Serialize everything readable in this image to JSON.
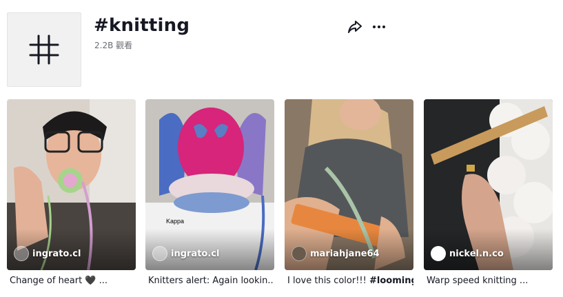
{
  "hashtag": {
    "title": "#knitting",
    "views": "2.2B 觀看",
    "avatar_icon": "hashtag-icon"
  },
  "actions": {
    "share_icon": "share-icon",
    "more_icon": "more-icon"
  },
  "videos": [
    {
      "author": "ingrato.cl",
      "caption": "Change of heart 🖤 ...",
      "thumb_icon": "video-thumbnail"
    },
    {
      "author": "ingrato.cl",
      "caption": "Knitters alert: Again lookin...",
      "thumb_icon": "video-thumbnail"
    },
    {
      "author": "mariahjane64",
      "caption_plain": "I love this color!!! ",
      "caption_bold": "#looming...",
      "thumb_icon": "video-thumbnail"
    },
    {
      "author": "nickel.n.co",
      "caption": "Warp speed knitting ...",
      "thumb_icon": "video-thumbnail"
    }
  ]
}
